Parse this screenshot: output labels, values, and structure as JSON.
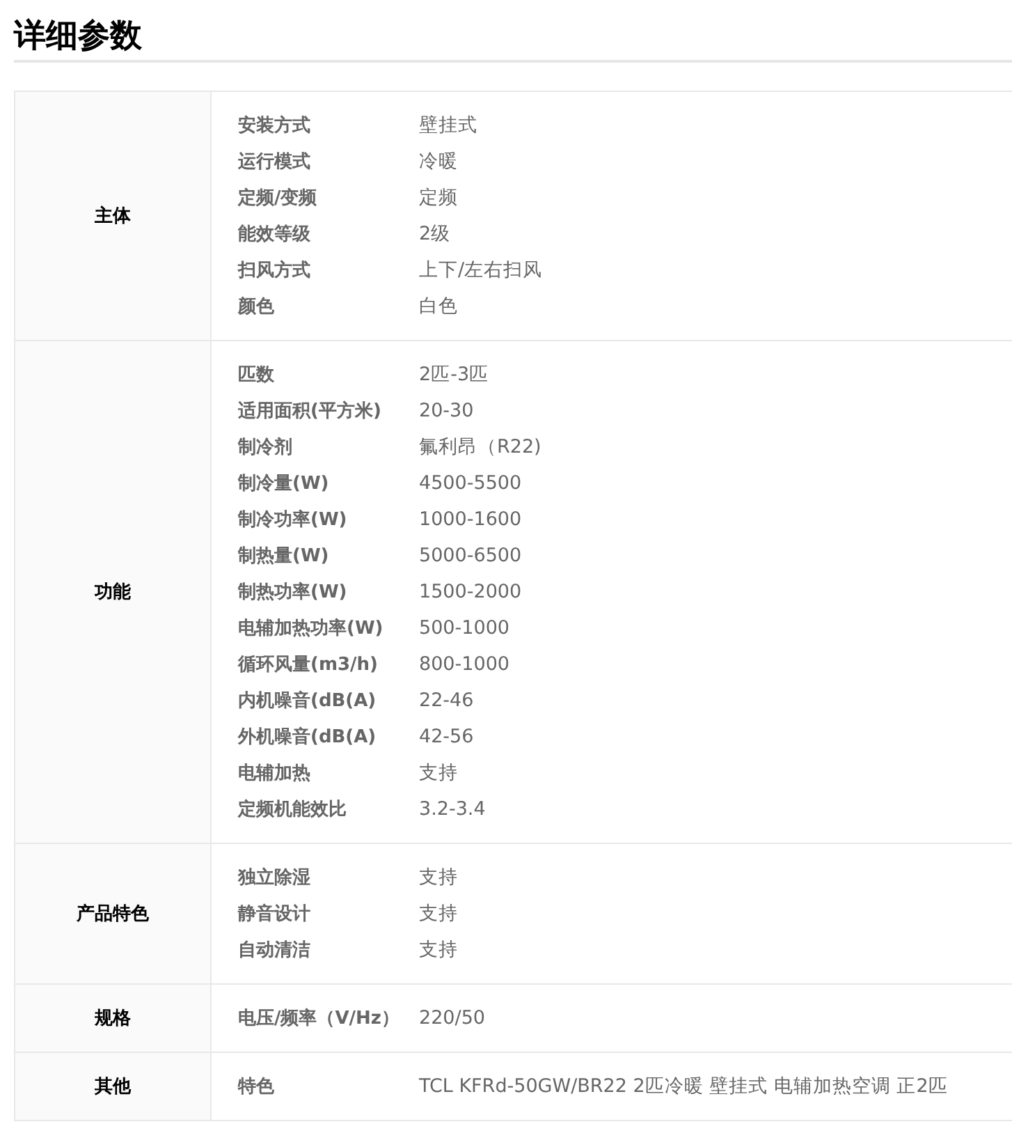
{
  "title": "详细参数",
  "groups": [
    {
      "heading": "主体",
      "params": [
        {
          "label": "安装方式",
          "value": "壁挂式"
        },
        {
          "label": "运行模式",
          "value": "冷暖"
        },
        {
          "label": "定频/变频",
          "value": "定频"
        },
        {
          "label": "能效等级",
          "value": "2级"
        },
        {
          "label": "扫风方式",
          "value": "上下/左右扫风"
        },
        {
          "label": "颜色",
          "value": "白色"
        }
      ]
    },
    {
      "heading": "功能",
      "params": [
        {
          "label": "匹数",
          "value": "2匹-3匹"
        },
        {
          "label": "适用面积(平方米)",
          "value": "20-30"
        },
        {
          "label": "制冷剂",
          "value": "氟利昂（R22)"
        },
        {
          "label": "制冷量(W)",
          "value": "4500-5500"
        },
        {
          "label": "制冷功率(W)",
          "value": "1000-1600"
        },
        {
          "label": "制热量(W)",
          "value": "5000-6500"
        },
        {
          "label": "制热功率(W)",
          "value": "1500-2000"
        },
        {
          "label": "电辅加热功率(W)",
          "value": "500-1000"
        },
        {
          "label": "循环风量(m3/h)",
          "value": "800-1000"
        },
        {
          "label": "内机噪音(dB(A)",
          "value": "22-46"
        },
        {
          "label": "外机噪音(dB(A)",
          "value": "42-56"
        },
        {
          "label": "电辅加热",
          "value": "支持"
        },
        {
          "label": "定频机能效比",
          "value": "3.2-3.4"
        }
      ]
    },
    {
      "heading": "产品特色",
      "params": [
        {
          "label": "独立除湿",
          "value": "支持"
        },
        {
          "label": "静音设计",
          "value": "支持"
        },
        {
          "label": "自动清洁",
          "value": "支持"
        }
      ]
    },
    {
      "heading": "规格",
      "params": [
        {
          "label": "电压/频率（V/Hz）",
          "value": "220/50"
        }
      ]
    },
    {
      "heading": "其他",
      "params": [
        {
          "label": "特色",
          "value": "TCL KFRd-50GW/BR22 2匹冷暖 壁挂式 电辅加热空调 正2匹"
        }
      ]
    }
  ]
}
